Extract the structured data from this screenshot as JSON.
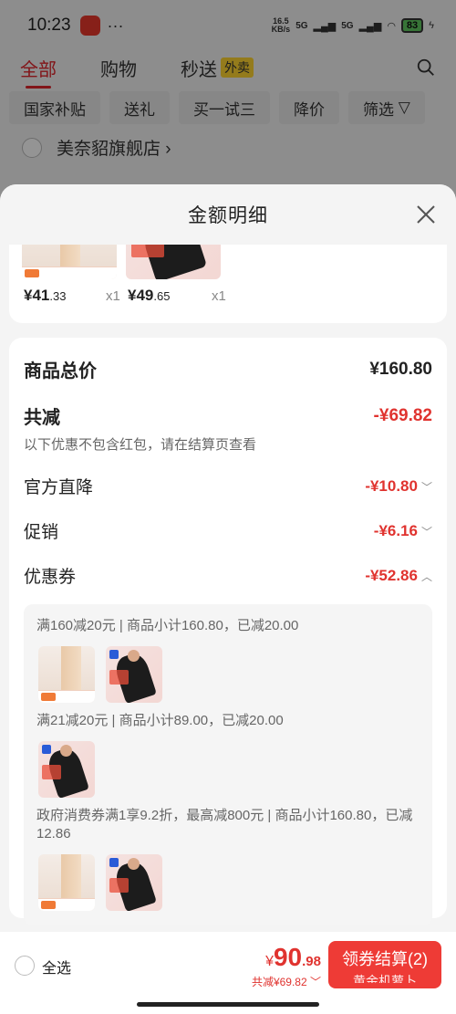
{
  "status": {
    "time": "10:23",
    "net_speed": "16.5",
    "net_unit": "KB/s",
    "signal1": "5G",
    "signal2": "5G",
    "battery": "83"
  },
  "tabs": [
    {
      "label": "全部"
    },
    {
      "label": "购物"
    },
    {
      "label": "秒送",
      "badge": "外卖"
    }
  ],
  "chips": [
    "国家补贴",
    "送礼",
    "买一试三",
    "降价",
    "筛选"
  ],
  "store": {
    "name": "美奈貂旗舰店"
  },
  "sheet": {
    "title": "金额明细",
    "products": [
      {
        "price_int": "¥41",
        "price_dec": ".33",
        "qty": "x1"
      },
      {
        "price_int": "¥49",
        "price_dec": ".65",
        "qty": "x1"
      }
    ],
    "total_label": "商品总价",
    "total_value": "¥160.80",
    "discount_label": "共减",
    "discount_value": "-¥69.82",
    "discount_note": "以下优惠不包含红包，请在结算页查看",
    "items": [
      {
        "label": "官方直降",
        "value": "-¥10.80"
      },
      {
        "label": "促销",
        "value": "-¥6.16"
      },
      {
        "label": "优惠券",
        "value": "-¥52.86"
      }
    ],
    "coupons": [
      {
        "text": "满160减20元 | 商品小计160.80，已减20.00"
      },
      {
        "text": "满21减20元 | 商品小计89.00，已减20.00"
      },
      {
        "text": "政府消费券满1享9.2折，最高减800元 | 商品小计160.80，已减12.86"
      }
    ]
  },
  "bottom": {
    "select_all": "全选",
    "total_prefix": "¥",
    "total_int": "90",
    "total_dec": ".98",
    "saved": "共减¥69.82",
    "checkout": "领券结算(2)",
    "checkout_sub": "黄金机萝卜"
  },
  "colors": {
    "accent": "#e0332f",
    "checkout_bg": "#ee3b36"
  }
}
